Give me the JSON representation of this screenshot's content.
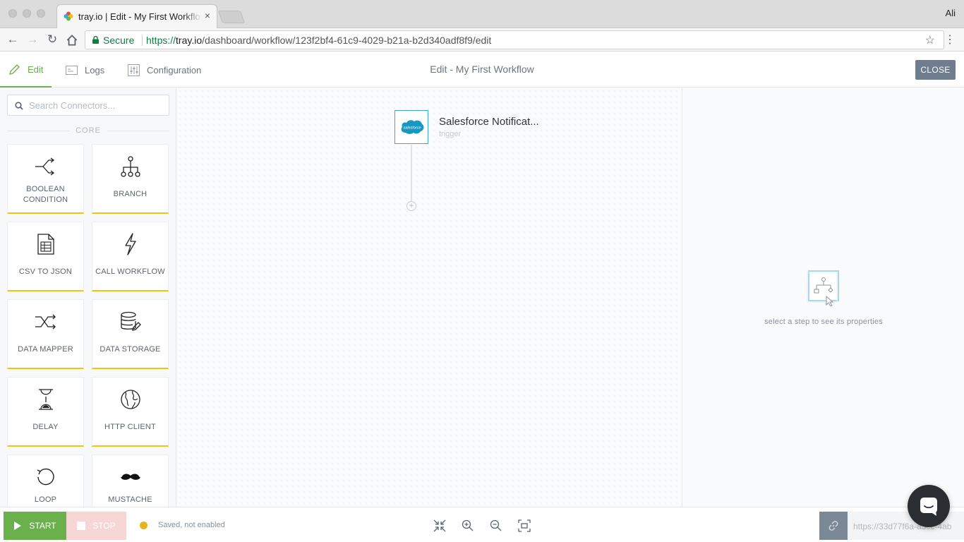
{
  "browser": {
    "tab_title": "tray.io | Edit - My First Workflow",
    "tab_close": "×",
    "profile": "Ali",
    "secure_label": "Secure",
    "url_scheme": "https://",
    "url_host": "tray.io",
    "url_path": "/dashboard/workflow/123f2bf4-61c9-4029-b21a-b2d340adf8f9/edit"
  },
  "header": {
    "tabs": [
      {
        "label": "Edit",
        "icon": "pencil-icon",
        "active": true
      },
      {
        "label": "Logs",
        "icon": "logs-icon",
        "active": false
      },
      {
        "label": "Configuration",
        "icon": "sliders-icon",
        "active": false
      }
    ],
    "title": "Edit - My First Workflow",
    "close_label": "CLOSE"
  },
  "sidebar": {
    "search_placeholder": "Search Connectors...",
    "section_label": "CORE",
    "accent_color": "#f1c40f",
    "connectors": [
      {
        "label": "BOOLEAN CONDITION",
        "icon": "boolean-condition-icon"
      },
      {
        "label": "BRANCH",
        "icon": "branch-icon"
      },
      {
        "label": "CSV TO JSON",
        "icon": "csv-document-icon"
      },
      {
        "label": "CALL WORKFLOW",
        "icon": "lightning-icon"
      },
      {
        "label": "DATA MAPPER",
        "icon": "shuffle-icon"
      },
      {
        "label": "DATA STORAGE",
        "icon": "database-edit-icon"
      },
      {
        "label": "DELAY",
        "icon": "hourglass-icon"
      },
      {
        "label": "HTTP CLIENT",
        "icon": "globe-icon"
      },
      {
        "label": "LOOP",
        "icon": "loop-icon"
      },
      {
        "label": "MUSTACHE",
        "icon": "mustache-icon"
      }
    ]
  },
  "canvas": {
    "step": {
      "title": "Salesforce Notificat...",
      "subtitle": "trigger",
      "logo_text": "salesforce",
      "icon": "salesforce-logo-icon"
    }
  },
  "properties": {
    "hint": "select a step to see its properties"
  },
  "footer": {
    "start_label": "START",
    "stop_label": "STOP",
    "status": "Saved, not enabled",
    "status_color": "#e6b31e",
    "webhook_url": "https://33d77f6a-a3cc-4ab",
    "tools": [
      "collapse-icon",
      "zoom-in-icon",
      "zoom-out-icon",
      "fit-screen-icon"
    ]
  }
}
